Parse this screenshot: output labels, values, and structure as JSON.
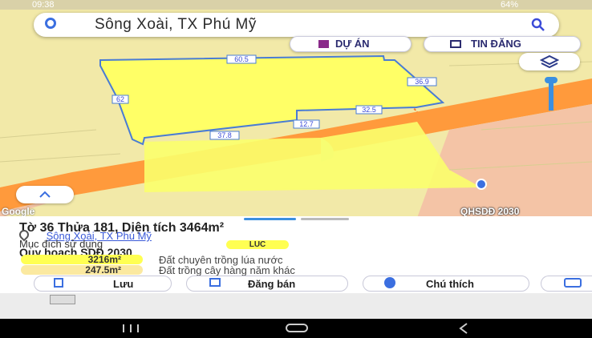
{
  "status_bar": {
    "time": "09:38",
    "battery": "64%"
  },
  "search": {
    "query": "Sông Xoài, TX Phú Mỹ"
  },
  "map_buttons": {
    "projects": "DỰ ÁN",
    "news": "TIN ĐĂNG"
  },
  "map": {
    "edge_labels": [
      "60.5",
      "36.9",
      "62",
      "32.5",
      "12.7",
      "37.8"
    ],
    "google_logo": "Google",
    "overlay_label": "QHSDĐ 2030"
  },
  "parcel": {
    "title": "Tờ 36 Thửa 181, Diện tích 3464m²",
    "location": "Sông Xoài, TX Phú Mỹ",
    "usage_label": "Mục đích sử dụng",
    "usage_code": "LUC",
    "planning_title": "Quy hoạch SDĐ 2030",
    "zones": [
      {
        "area": "3216m²",
        "purpose": "Đất chuyên trồng lúa nước",
        "color": "#ffff52"
      },
      {
        "area": "247.5m²",
        "purpose": "Đất trồng cây hàng năm khác",
        "color": "#fbe9a0"
      }
    ]
  },
  "actions": {
    "save": "Lưu",
    "post_sale": "Đăng bán",
    "legend": "Chú thích"
  },
  "colors": {
    "accent": "#3b4bd8",
    "parcel_fill": "#ffff66",
    "map_bg": "#f2e9a8",
    "road": "#ff9a3c"
  },
  "icons": [
    "search-icon",
    "target-icon",
    "building-icon",
    "news-icon",
    "layers-icon",
    "chevron-up-icon",
    "add-bookmark-icon",
    "post-icon",
    "info-icon",
    "camera-icon"
  ]
}
